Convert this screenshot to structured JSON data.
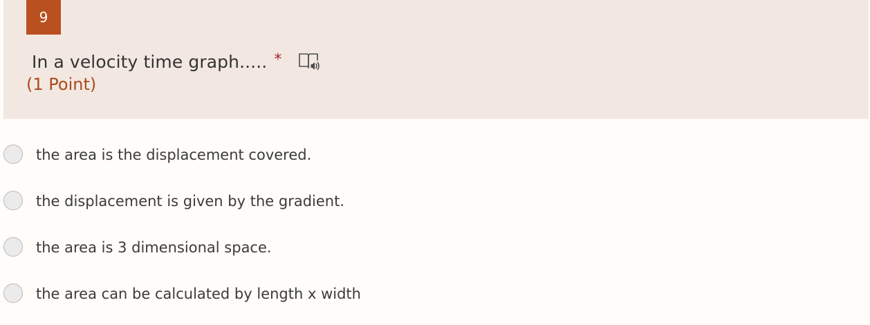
{
  "question": {
    "number": "9",
    "title": "In a velocity time graph.....",
    "required_marker": "*",
    "points": "(1 Point)"
  },
  "icons": {
    "reader": "immersive-reader-icon"
  },
  "options": [
    {
      "label": "the area is the displacement covered.",
      "selected": false
    },
    {
      "label": "the displacement is given by the gradient.",
      "selected": false
    },
    {
      "label": "the area is 3 dimensional space.",
      "selected": false
    },
    {
      "label": "the area can be calculated by length x width",
      "selected": false
    }
  ],
  "colors": {
    "accent": "#b9501f",
    "header_background": "#f3e8e1",
    "page_background": "#fffcf9",
    "required": "#a4262c",
    "points_text": "#a84a1c"
  }
}
